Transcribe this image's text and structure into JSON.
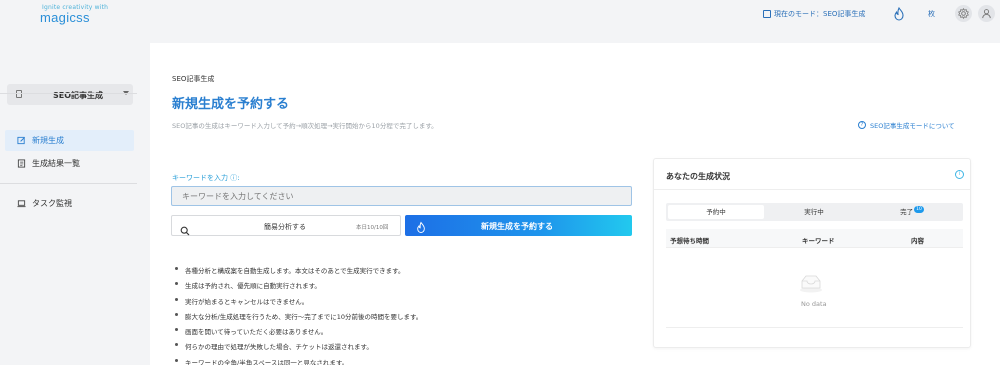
{
  "header": {
    "logo_tagline": "Ignite creativity with",
    "logo_brand": "magicss",
    "mode_label": "現在のモード：SEO記事生成",
    "ticket_count": "枚",
    "icons": [
      "document-icon",
      "flame-icon",
      "gear-icon",
      "user-icon"
    ]
  },
  "sidebar": {
    "mode_select": "SEO記事生成",
    "items": [
      {
        "label": "新規生成",
        "icon": "edit-icon",
        "active": true
      },
      {
        "label": "生成結果一覧",
        "icon": "list-icon",
        "active": false
      },
      {
        "label": "タスク監視",
        "icon": "monitor-icon",
        "active": false
      }
    ]
  },
  "main": {
    "breadcrumb": "SEO記事生成",
    "title": "新規生成を予約する",
    "description": "SEO記事の生成はキーワード入力して予約→順次処理→実行開始から10分程で完了します。",
    "about_link": "SEO記事生成モードについて",
    "keyword_label": "キーワードを入力 ⓘ:",
    "keyword_placeholder": "キーワードを入力してください",
    "analyze_button": "簡易分析する",
    "analyze_quota": "本日10/10回",
    "reserve_button": "新規生成を予約する",
    "notes": [
      "各種分析と構成案を自動生成します。本文はそのあとで生成実行できます。",
      "生成は予約され、優先順に自動実行されます。",
      "実行が始まるとキャンセルはできません。",
      "膨大な分析/生成処理を行うため、実行～完了までに10分前後の時間を要します。",
      "画面を開いて待っていただく必要はありません。",
      "何らかの理由で処理が失敗した場合、チケットは返還されます。",
      "キーワードの全角/半角スペースは同一と見なされます。"
    ]
  },
  "status_panel": {
    "title": "あなたの生成状況",
    "tabs": [
      {
        "label": "予約中",
        "selected": true
      },
      {
        "label": "実行中",
        "selected": false
      },
      {
        "label": "完了",
        "selected": false,
        "badge": "10"
      }
    ],
    "columns": [
      "予想待ち時間",
      "キーワード",
      "内容"
    ],
    "empty_text": "No data"
  },
  "colors": {
    "accent": "#2a7fd0",
    "gradient_start": "#1d6fe6",
    "gradient_end": "#22c9ee"
  }
}
